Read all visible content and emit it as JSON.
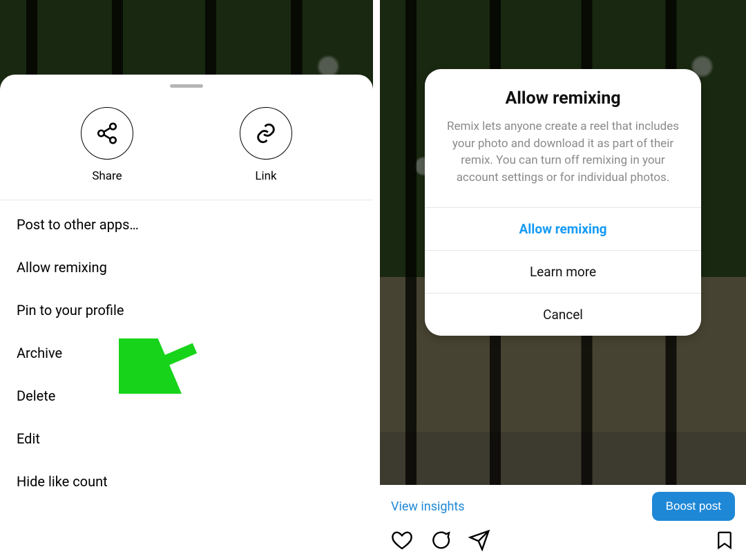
{
  "left_sheet": {
    "actions": {
      "share": {
        "label": "Share",
        "icon": "share-icon"
      },
      "link": {
        "label": "Link",
        "icon": "link-icon"
      }
    },
    "menu": [
      {
        "label": "Post to other apps…"
      },
      {
        "label": "Allow remixing"
      },
      {
        "label": "Pin to your profile"
      },
      {
        "label": "Archive"
      },
      {
        "label": "Delete"
      },
      {
        "label": "Edit"
      },
      {
        "label": "Hide like count"
      }
    ]
  },
  "right_dialog": {
    "title": "Allow remixing",
    "body": "Remix lets anyone create a reel that includes your photo and download it as part of their remix. You can turn off remixing in your account settings or for individual photos.",
    "primary_label": "Allow remixing",
    "learn_label": "Learn more",
    "cancel_label": "Cancel"
  },
  "right_post": {
    "insights_label": "View insights",
    "boost_label": "Boost post"
  },
  "annotation": {
    "arrow_color": "#17d41a"
  }
}
